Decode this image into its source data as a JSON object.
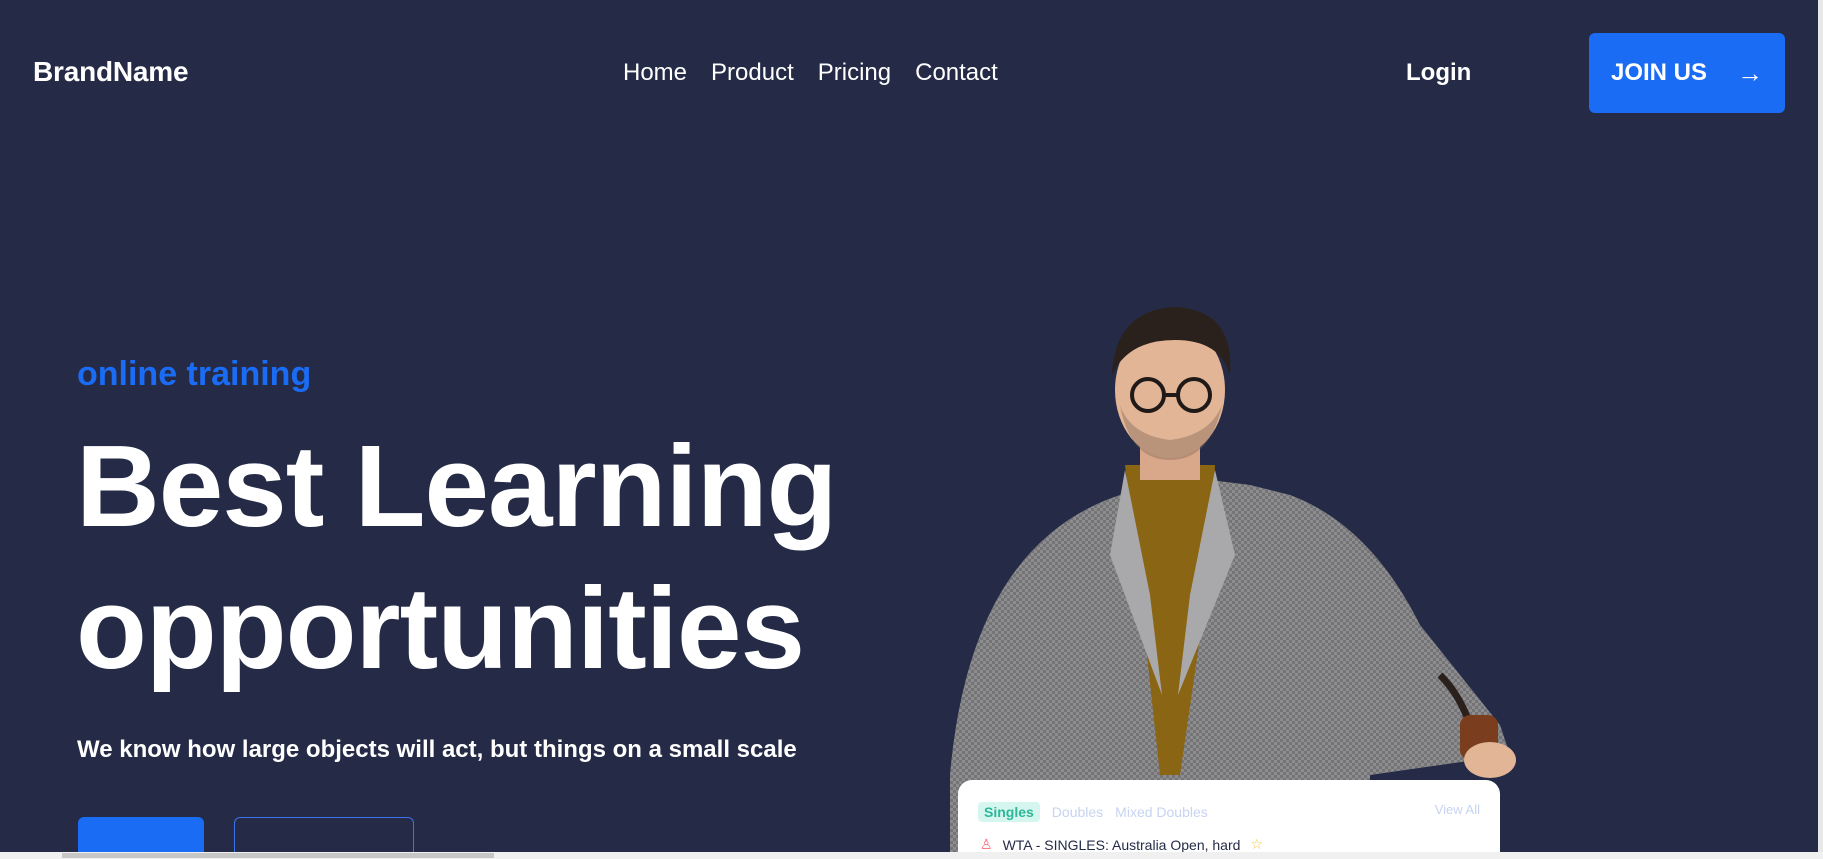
{
  "nav": {
    "brand": "BrandName",
    "links": [
      "Home",
      "Product",
      "Pricing",
      "Contact"
    ],
    "login": "Login",
    "join": "JOIN US",
    "join_icon": "arrow-right-icon"
  },
  "hero": {
    "eyebrow": "online training",
    "headline_line1": "Best Learning",
    "headline_line2": "opportunities",
    "subtext": "We know how large objects will act, but things on a small scale"
  },
  "card": {
    "tabs": [
      "Singles",
      "Doubles",
      "Mixed Doubles"
    ],
    "view_all": "View All",
    "row_text": "WTA - SINGLES: Australia Open, hard"
  },
  "colors": {
    "background": "#252b46",
    "accent": "#1a6cf5",
    "text": "#ffffff"
  }
}
